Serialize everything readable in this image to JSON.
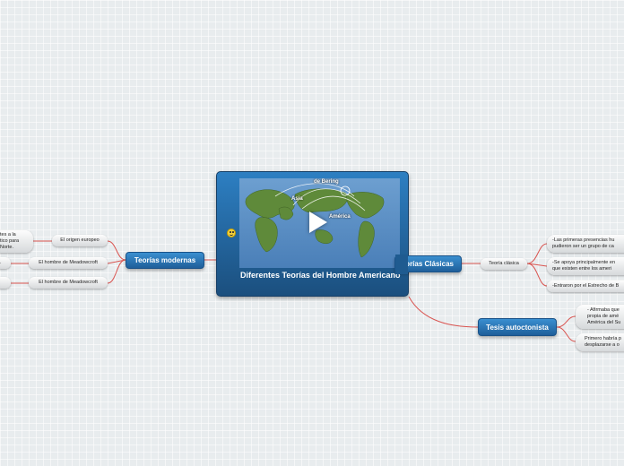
{
  "central": {
    "title": "Diferentes Teorías del Hombre Americano",
    "image_labels": {
      "bering": "de Bering",
      "asia": "Asia",
      "america": "América"
    },
    "icons": [
      "play-icon",
      "smiley-icon"
    ]
  },
  "left_branch": {
    "title": "Teorías modernas",
    "items": [
      {
        "label": "El origen europeo",
        "detail": "tes a la\ntico para\nNorte."
      },
      {
        "label": "El hombre de Meadowcroft",
        "detail": "."
      },
      {
        "label": "El hombre de Meadowcroft",
        "detail": ""
      }
    ]
  },
  "right_branches": [
    {
      "title": "Teorías Clásicas",
      "items": [
        {
          "label": "Teoría clásica",
          "details": [
            "-Las primeras presencias hu\npudieron ser un grupo de ca",
            "-Se apoya principalmente en\nque existen entre los ameri",
            "-Entraron por el Estrecho de B"
          ]
        }
      ]
    },
    {
      "title": "Tesis autoctonista",
      "details": [
        "- Afirmaba que\npropia de amé\nAmérica del Su",
        "Primero habría p\ndesplazarse a o"
      ]
    }
  ],
  "colors": {
    "link": "#d9534f",
    "node_blue": "#2a72b5",
    "background": "#e8ecee"
  }
}
